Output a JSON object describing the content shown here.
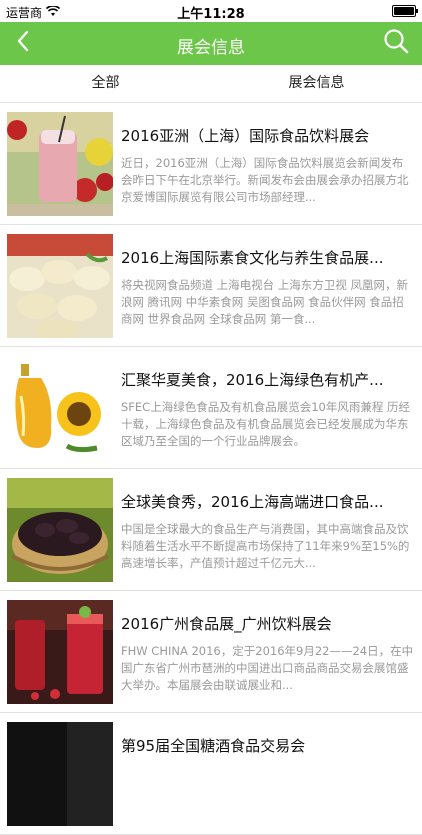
{
  "status": {
    "carrier": "运营商",
    "time": "上午11:28",
    "battery_level": 1.0
  },
  "nav": {
    "title": "展会信息",
    "back_icon": "chevron-left-icon",
    "search_icon": "search-icon"
  },
  "tabs": [
    {
      "label": "全部"
    },
    {
      "label": "展会信息"
    }
  ],
  "items": [
    {
      "title": "2016亚洲（上海）国际食品饮料展会",
      "desc": "近日，2016亚洲（上海）国际食品饮料展览会新闻发布会昨日下午在北京举行。新闻发布会由展会承办招展方北京爱博国际展览有限公司市场部经理..."
    },
    {
      "title": "2016上海国际素食文化与养生食品展...",
      "desc": "将央视网食品频道 上海电视台 上海东方卫视 凤凰网，新浪网 腾讯网 中华素食网 吴图食品网 食品伙伴网 食品招商网 世界食品网 全球食品网 第一食..."
    },
    {
      "title": "汇聚华夏美食，2016上海绿色有机产...",
      "desc": "SFEC上海绿色食品及有机食品展览会10年风雨兼程 历经十载，上海绿色食品及有机食品展览会已经发展成为华东区域乃至全国的一个行业品牌展会。"
    },
    {
      "title": "全球美食秀，2016上海高端进口食品...",
      "desc": "中国是全球最大的食品生产与消费国，其中高端食品及饮料随着生活水平不断提高市场保持了11年来9%至15%的高速增长率，产值预计超过千亿元大..."
    },
    {
      "title": "2016广州食品展_广州饮料展会",
      "desc": "FHW CHINA 2016，定于2016年9月22——24日，在中国广东省广州市琶洲的中国进出口商品商品交易会展馆盛大举办。本届展会由联诚展业和..."
    },
    {
      "title": "第95届全国糖酒食品交易会",
      "desc": ""
    }
  ]
}
